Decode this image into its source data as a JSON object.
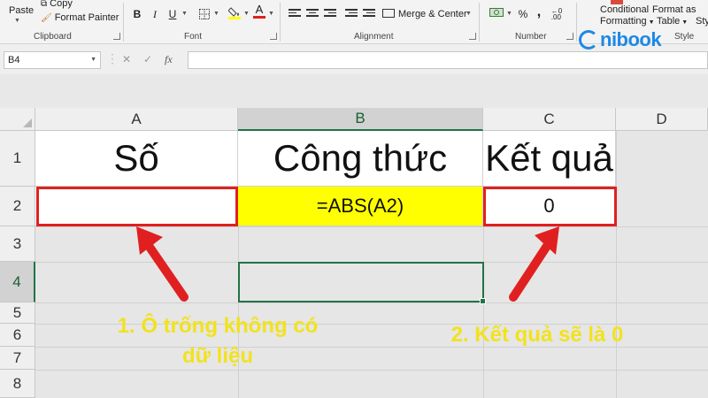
{
  "ribbon": {
    "clipboard": {
      "paste": "Paste",
      "copy": "Copy",
      "format_painter": "Format Painter",
      "label": "Clipboard"
    },
    "font": {
      "label": "Font",
      "bold": "B",
      "italic": "I",
      "underline": "U"
    },
    "alignment": {
      "label": "Alignment",
      "merge_center": "Merge & Center"
    },
    "number": {
      "label": "Number",
      "percent": "%",
      "comma": ","
    },
    "styles": {
      "conditional": "Conditional",
      "formatting": "Formatting",
      "format_as": "Format as",
      "table": "Table",
      "styl": "Styl",
      "label": "Style"
    }
  },
  "logo": {
    "text": "nibook"
  },
  "formula_bar": {
    "name_box": "B4",
    "cancel": "✕",
    "enter": "✓",
    "fx": "fx",
    "value": ""
  },
  "columns": [
    "A",
    "B",
    "C",
    "D"
  ],
  "rows": [
    "1",
    "2",
    "3",
    "4",
    "5",
    "6",
    "7",
    "8"
  ],
  "cells": {
    "A1": "Số",
    "B1": "Công thức",
    "C1": "Kết quả",
    "A2": "",
    "B2": "=ABS(A2)",
    "C2": "0"
  },
  "annotations": {
    "note1_line1": "1. Ô trống không có",
    "note1_line2": "dữ liệu",
    "note2": "2. Kết quả sẽ là 0"
  },
  "colors": {
    "annotation_red": "#e02020",
    "annotation_yellow": "#f2e21e",
    "cell_fill_yellow": "#ffff00",
    "selection_green": "#217346",
    "logo_blue": "#1e88e5"
  }
}
